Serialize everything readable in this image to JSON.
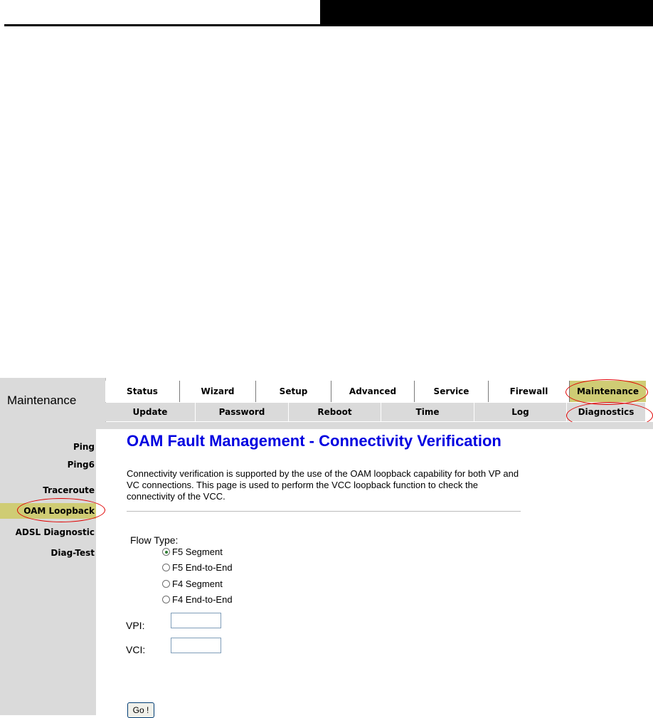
{
  "brand_title": "Maintenance",
  "top_menu": [
    {
      "label": "Status",
      "active": false
    },
    {
      "label": "Wizard",
      "active": false
    },
    {
      "label": "Setup",
      "active": false
    },
    {
      "label": "Advanced",
      "active": false
    },
    {
      "label": "Service",
      "active": false
    },
    {
      "label": "Firewall",
      "active": false
    },
    {
      "label": "Maintenance",
      "active": true
    }
  ],
  "sub_menu": [
    {
      "label": "Update",
      "active": false
    },
    {
      "label": "Password",
      "active": false
    },
    {
      "label": "Reboot",
      "active": false
    },
    {
      "label": "Time",
      "active": false
    },
    {
      "label": "Log",
      "active": false
    },
    {
      "label": "Diagnostics",
      "active": false
    }
  ],
  "sidebar": [
    {
      "label": "Ping",
      "active": false
    },
    {
      "label": "Ping6",
      "active": false
    },
    {
      "label": "Traceroute",
      "active": false
    },
    {
      "label": "OAM Loopback",
      "active": true
    },
    {
      "label": "ADSL Diagnostic",
      "active": false
    },
    {
      "label": "Diag-Test",
      "active": false
    }
  ],
  "page": {
    "title": "OAM Fault Management - Connectivity Verification",
    "description": "Connectivity verification is supported by the use of the OAM loopback capability for both VP and VC connections. This page is used to perform the VCC loopback function to check the connectivity of the VCC.",
    "flow_type_label": "Flow Type:",
    "flow_options": [
      {
        "label": "F5 Segment",
        "checked": true
      },
      {
        "label": "F5 End-to-End",
        "checked": false
      },
      {
        "label": "F4 Segment",
        "checked": false
      },
      {
        "label": "F4 End-to-End",
        "checked": false
      }
    ],
    "vpi_label": "VPI:",
    "vpi_value": "",
    "vci_label": "VCI:",
    "vci_value": "",
    "go_label": "Go !"
  },
  "colors": {
    "accent": "#cfcc74",
    "title_blue": "#0000e0",
    "panel_gray": "#dadada",
    "highlight_ring": "#e00000"
  }
}
